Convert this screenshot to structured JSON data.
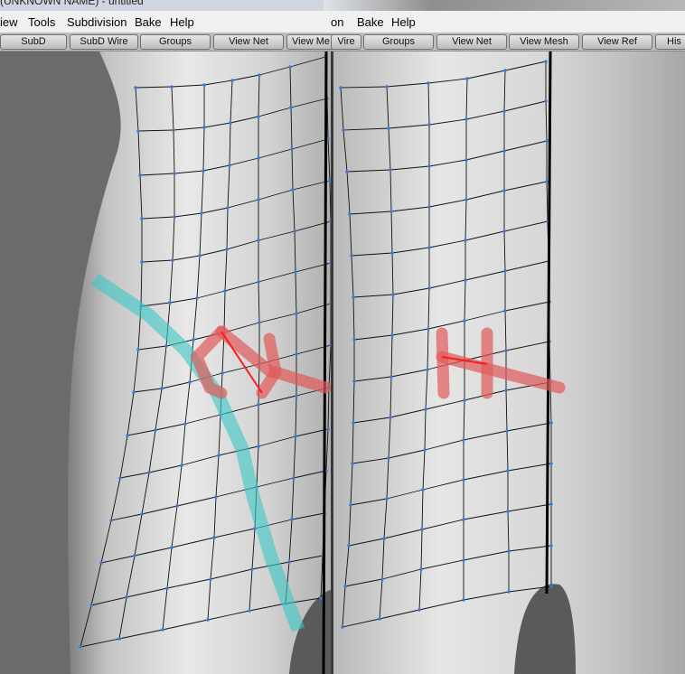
{
  "window": {
    "title": "(UNKNOWN NAME) - untitled"
  },
  "menubar_left": [
    "iew",
    "Tools",
    "Subdivision",
    "Bake",
    "Help"
  ],
  "menubar_right": [
    "on",
    "Bake",
    "Help"
  ],
  "toolbar_left": [
    "SubD",
    "SubD Wire",
    "Groups",
    "View Net",
    "View Me"
  ],
  "toolbar_right": [
    "Vire",
    "Groups",
    "View Net",
    "View Mesh",
    "View Ref",
    "His"
  ],
  "colors": {
    "wire": "#111111",
    "vertex": "#3a7bd5",
    "edge_loop_highlight": "#39c6c6",
    "pole_highlight": "#e15a5a",
    "selected_edge": "#ff1a1a",
    "background": "#6b6b6b"
  }
}
